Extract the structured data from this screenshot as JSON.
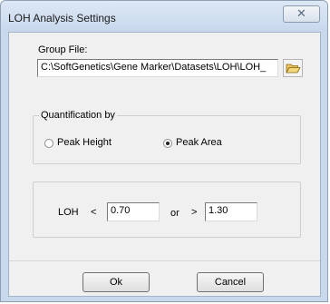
{
  "dialog": {
    "title": "LOH Analysis Settings",
    "close_glyph": "☒"
  },
  "group_file": {
    "label": "Group File:",
    "path": "C:\\SoftGenetics\\Gene Marker\\Datasets\\LOH\\LOH_",
    "browse_icon": "folder-open-icon"
  },
  "quantification": {
    "legend": "Quantification by",
    "options": [
      {
        "label": "Peak Height",
        "checked": false
      },
      {
        "label": "Peak Area",
        "checked": true
      }
    ]
  },
  "loh": {
    "label": "LOH",
    "less_than": "<",
    "low_value": "0.70",
    "or_label": "or",
    "greater_than": ">",
    "high_value": "1.30"
  },
  "buttons": {
    "ok": "Ok",
    "cancel": "Cancel"
  }
}
